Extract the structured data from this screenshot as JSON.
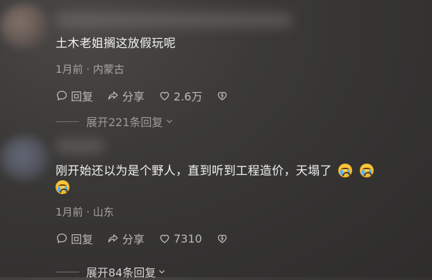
{
  "comments": [
    {
      "text": "土木老姐搁这放假玩呢",
      "meta": "1月前 · 内蒙古",
      "actions": {
        "reply": "回复",
        "share": "分享",
        "likes": "2.6万"
      },
      "expand": "展开221条回复"
    },
    {
      "text": "刚开始还以为是个野人，直到听到工程造价，天塌了",
      "emoji": [
        "crying-face",
        "crying-face",
        "crying-face"
      ],
      "meta": "1月前 · 山东",
      "actions": {
        "reply": "回复",
        "share": "分享",
        "likes": "7310"
      },
      "expand": "展开84条回复"
    }
  ],
  "icons": [
    "reply-icon",
    "share-icon",
    "like-heart-icon",
    "dislike-heart-icon",
    "chevron-down-icon"
  ]
}
